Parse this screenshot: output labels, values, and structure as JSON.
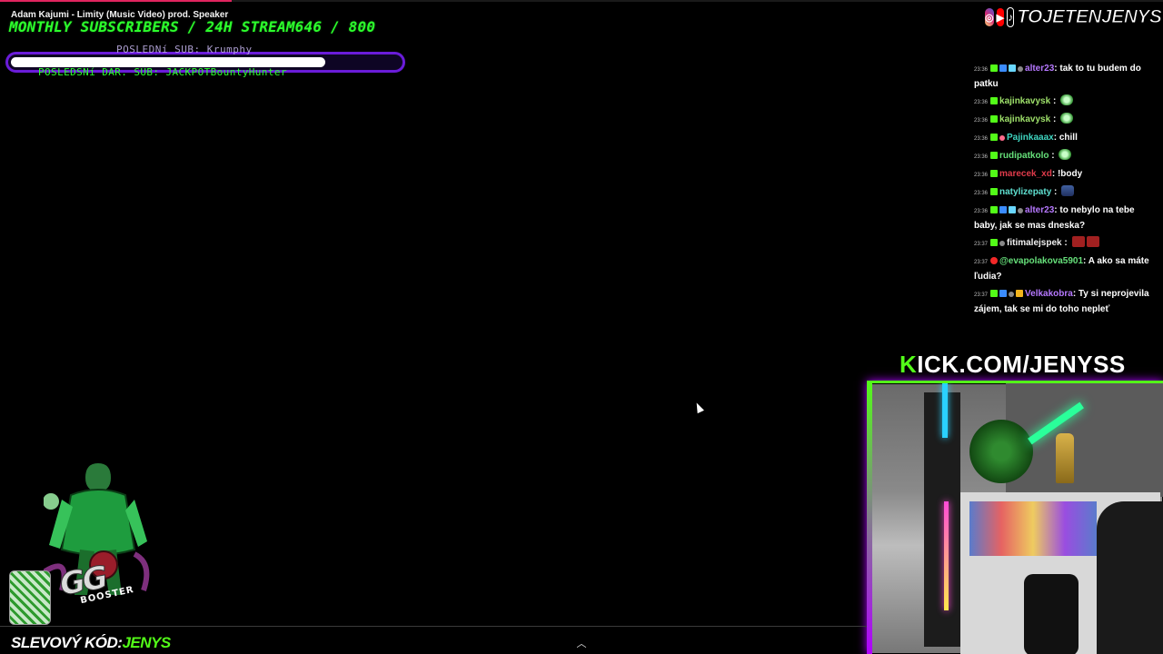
{
  "now_playing": {
    "title": "Adam Kajumi - Limity (Music Video) prod. Speaker"
  },
  "goal": {
    "title": "MONTHLY SUBSCRIBERS / 24H STREAM",
    "current": "646",
    "separator": " / ",
    "target": "800",
    "progress_fraction": 0.8075
  },
  "last_sub": {
    "label": "POSLEDNí SUB:",
    "name": "Krumphy"
  },
  "last_gift": {
    "label": "POSLEDSNí DAR. SUB:",
    "name": "JACKPOTBountyHunter"
  },
  "socials": {
    "icons": [
      "instagram-icon",
      "youtube-icon",
      "tiktok-icon"
    ],
    "handle": "TOJETENJENYS"
  },
  "chat": {
    "faded_tail": "...  ...  ...",
    "messages": [
      {
        "time": "23:36",
        "badges": [
          "b-kick",
          "b-blue",
          "b-cyan",
          "b-gray"
        ],
        "user": "alter23",
        "color": "#b678ff",
        "text": ": tak to tu budem do patku"
      },
      {
        "time": "23:36",
        "badges": [
          "b-kick"
        ],
        "user": "kajinkavysk",
        "color": "#9ee06a",
        "text": " : ",
        "emotes": [
          "em-green"
        ]
      },
      {
        "time": "23:36",
        "badges": [
          "b-kick"
        ],
        "user": "kajinkavysk",
        "color": "#9ee06a",
        "text": " : ",
        "emotes": [
          "em-green"
        ]
      },
      {
        "time": "23:36",
        "badges": [
          "b-kick",
          "b-pink"
        ],
        "user": "Pajinkaaax",
        "color": "#3fd6c1",
        "text": ": chill"
      },
      {
        "time": "23:36",
        "badges": [
          "b-kick"
        ],
        "user": "rudipatkolo",
        "color": "#66e07a",
        "text": " : ",
        "emotes": [
          "em-green"
        ]
      },
      {
        "time": "23:36",
        "badges": [
          "b-kick"
        ],
        "user": "marecek_xd",
        "color": "#e03b4b",
        "text": ": !body"
      },
      {
        "time": "23:36",
        "badges": [
          "b-kick"
        ],
        "user": "natylizepaty",
        "color": "#5fe0d1",
        "text": " : ",
        "emotes": [
          "em-car"
        ]
      },
      {
        "time": "23:36",
        "badges": [
          "b-kick",
          "b-blue",
          "b-cyan",
          "b-gray"
        ],
        "user": "alter23",
        "color": "#b678ff",
        "text": ": to nebylo na tebe baby, jak se mas dneska?"
      },
      {
        "time": "23:37",
        "badges": [
          "b-kick",
          "b-gray"
        ],
        "user": "fitimalejspek",
        "color": "#f0f0f0",
        "text": " : ",
        "emotes": [
          "em-red",
          "em-red"
        ]
      },
      {
        "time": "23:37",
        "badges": [
          "b-red"
        ],
        "user": "@evapolakova5901",
        "color": "#66e07a",
        "text": ": A ako sa máte ľudia?"
      },
      {
        "time": "23:37",
        "badges": [
          "b-kick",
          "b-blue",
          "b-gray",
          "b-gold"
        ],
        "user": "Velkakobra",
        "color": "#b678ff",
        "text": ": Ty si neprojevila zájem, tak se mi do toho nepleť"
      }
    ]
  },
  "kick": {
    "k": "K",
    "rest": "ICK.COM/JENYSS"
  },
  "sponsor": {
    "brand": "GG",
    "sub": "BOOSTER"
  },
  "promo": {
    "label": "SLEVOVÝ KÓD:",
    "code": "JENYS"
  },
  "colors": {
    "accent_green": "#53fc18",
    "accent_purple": "#b000ff",
    "goal_green": "#2cff2c"
  }
}
